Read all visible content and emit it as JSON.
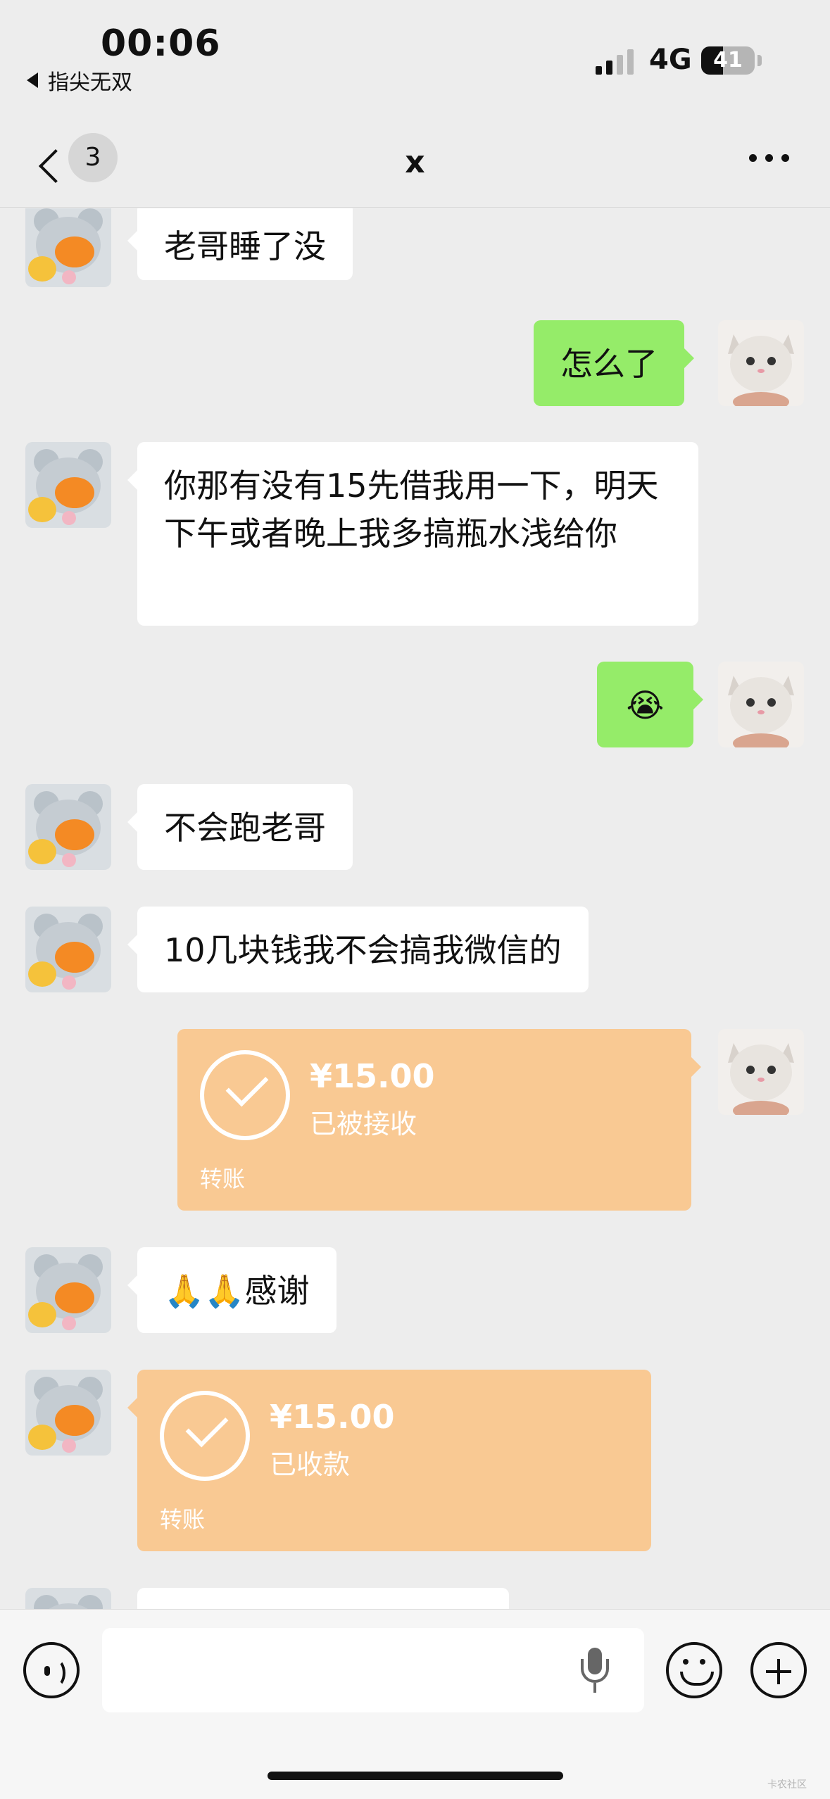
{
  "status_bar": {
    "time": "00:06",
    "back_app": "指尖无双",
    "network": "4G",
    "battery": "41"
  },
  "nav": {
    "unread_count": "3",
    "title": "x"
  },
  "messages": [
    {
      "side": "in",
      "type": "text",
      "text": "老哥睡了没"
    },
    {
      "side": "out",
      "type": "text",
      "text": "怎么了"
    },
    {
      "side": "in",
      "type": "text",
      "text": "你那有没有15先借我用一下，明天下午或者晚上我多搞瓶水浅给你"
    },
    {
      "side": "out",
      "type": "text",
      "text": "😭"
    },
    {
      "side": "in",
      "type": "text",
      "text": "不会跑老哥"
    },
    {
      "side": "in",
      "type": "text",
      "text": "10几块钱我不会搞我微信的"
    },
    {
      "side": "out",
      "type": "transfer",
      "amount": "¥15.00",
      "status": "已被接收",
      "label": "转账"
    },
    {
      "side": "in",
      "type": "text",
      "text": "🙏🙏感谢"
    },
    {
      "side": "in",
      "type": "transfer",
      "amount": "¥15.00",
      "status": "已收款",
      "label": "转账"
    }
  ],
  "input_bar": {
    "placeholder": ""
  },
  "watermark": "卡农社区",
  "colors": {
    "background": "#ededed",
    "incoming_bubble": "#ffffff",
    "outgoing_bubble": "#95ec69",
    "transfer_card": "#f9c993"
  },
  "icons": [
    "voice-icon",
    "microphone-icon",
    "emoji-icon",
    "plus-icon",
    "back-chevron-icon",
    "more-icon"
  ]
}
